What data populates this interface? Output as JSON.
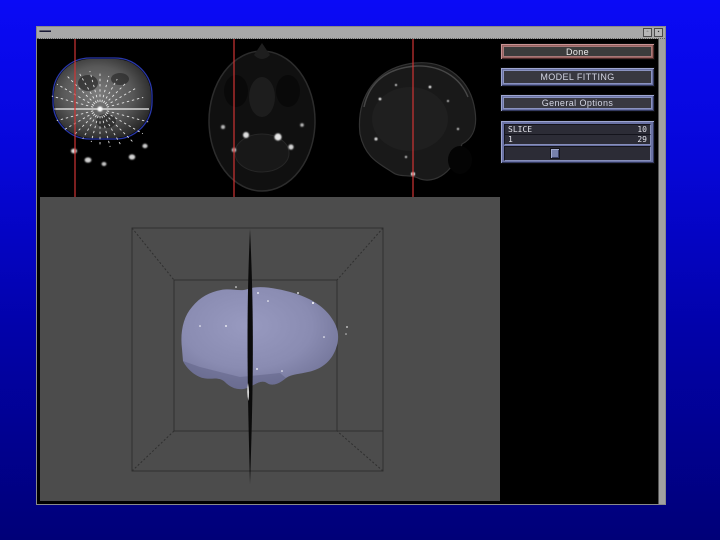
{
  "window": {
    "title": "▪▪▪▪▪▪▪▪▪▪▪",
    "controls": {
      "left_glyph": "▫",
      "right_glyph": "▪"
    }
  },
  "panel": {
    "done_label": "Done",
    "model_fitting_label": "MODEL FITTING",
    "general_options_label": "General Options",
    "slider": {
      "label": "SLICE",
      "value": "10",
      "min": "1",
      "max": "29"
    }
  },
  "viewer": {
    "slice_views": [
      {
        "name": "coronal slice with radial model-fit rays and contour"
      },
      {
        "name": "axial slice"
      },
      {
        "name": "sagittal slice"
      }
    ],
    "crosshair": "red vertical slice-position line in each view",
    "model": "3D lavender brain surface inside wireframe cube with dark cutting plane"
  },
  "colors": {
    "done_accent": "#96605e",
    "panel_accent": "#6a72a4",
    "crosshair_red": "#cf3434",
    "contour_blue": "#2b3bb5",
    "brain_surface": "#8e90b6",
    "viewport_bg": "#4c4c4c"
  }
}
